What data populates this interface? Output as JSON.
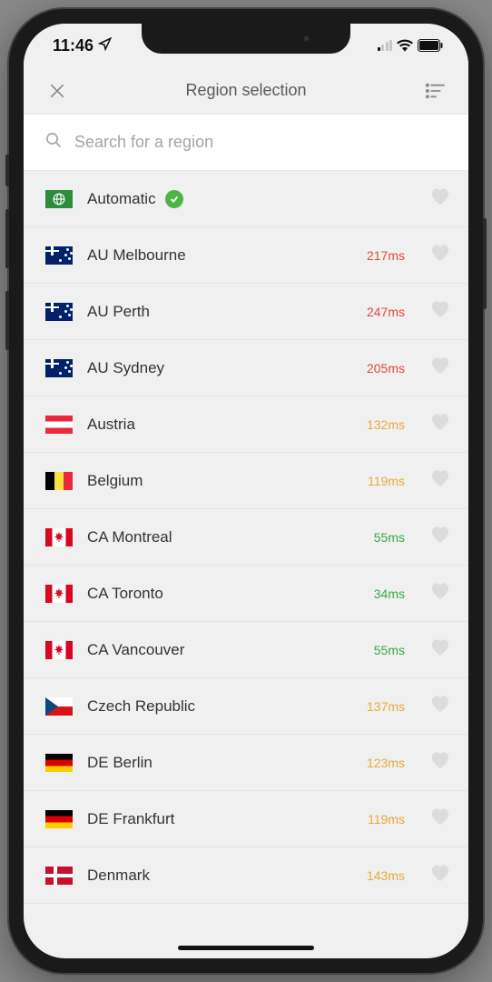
{
  "status": {
    "time": "11:46",
    "location_active": true
  },
  "header": {
    "title": "Region selection"
  },
  "search": {
    "placeholder": "Search for a region"
  },
  "regions": [
    {
      "name": "Automatic",
      "flag": "auto",
      "latency": null,
      "favorite": false,
      "selected": true
    },
    {
      "name": "AU Melbourne",
      "flag": "au",
      "latency": "217ms",
      "latency_class": "lat-red",
      "favorite": false
    },
    {
      "name": "AU Perth",
      "flag": "au",
      "latency": "247ms",
      "latency_class": "lat-red",
      "favorite": false
    },
    {
      "name": "AU Sydney",
      "flag": "au",
      "latency": "205ms",
      "latency_class": "lat-red",
      "favorite": false
    },
    {
      "name": "Austria",
      "flag": "at",
      "latency": "132ms",
      "latency_class": "lat-amber",
      "favorite": false
    },
    {
      "name": "Belgium",
      "flag": "be",
      "latency": "119ms",
      "latency_class": "lat-amber",
      "favorite": false
    },
    {
      "name": "CA Montreal",
      "flag": "ca",
      "latency": "55ms",
      "latency_class": "lat-green",
      "favorite": false
    },
    {
      "name": "CA Toronto",
      "flag": "ca",
      "latency": "34ms",
      "latency_class": "lat-green",
      "favorite": false
    },
    {
      "name": "CA Vancouver",
      "flag": "ca",
      "latency": "55ms",
      "latency_class": "lat-green",
      "favorite": false
    },
    {
      "name": "Czech Republic",
      "flag": "cz",
      "latency": "137ms",
      "latency_class": "lat-amber",
      "favorite": false
    },
    {
      "name": "DE Berlin",
      "flag": "de",
      "latency": "123ms",
      "latency_class": "lat-amber",
      "favorite": false
    },
    {
      "name": "DE Frankfurt",
      "flag": "de",
      "latency": "119ms",
      "latency_class": "lat-amber",
      "favorite": false
    },
    {
      "name": "Denmark",
      "flag": "dk",
      "latency": "143ms",
      "latency_class": "lat-amber",
      "favorite": false
    }
  ]
}
